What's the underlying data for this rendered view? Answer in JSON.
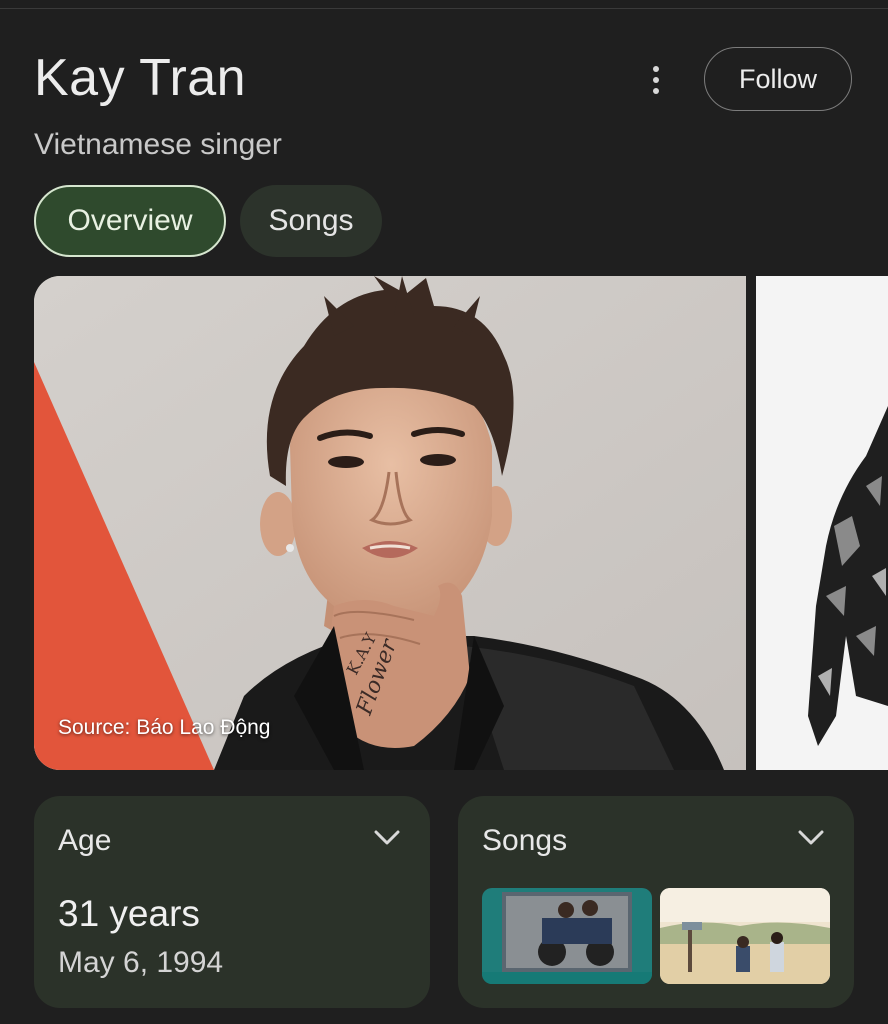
{
  "header": {
    "title": "Kay Tran",
    "subtitle": "Vietnamese singer",
    "follow_label": "Follow",
    "more_icon": "more-vert-icon"
  },
  "tabs": [
    {
      "label": "Overview",
      "active": true
    },
    {
      "label": "Songs",
      "active": false
    }
  ],
  "hero": {
    "source_label": "Source: Báo Lao Động",
    "hand_tattoo": "Flower",
    "finger_tattoo": "K.A.Y"
  },
  "cards": {
    "age": {
      "title": "Age",
      "value": "31 years",
      "date": "May 6, 1994"
    },
    "songs": {
      "title": "Songs"
    }
  },
  "colors": {
    "background": "#1f1f1f",
    "card_background": "#2b3229",
    "active_tab_background": "#2f4a2d",
    "active_tab_border": "#d6e6cf",
    "inactive_tab_background": "#2c332b",
    "accent_red": "#e2553b"
  }
}
